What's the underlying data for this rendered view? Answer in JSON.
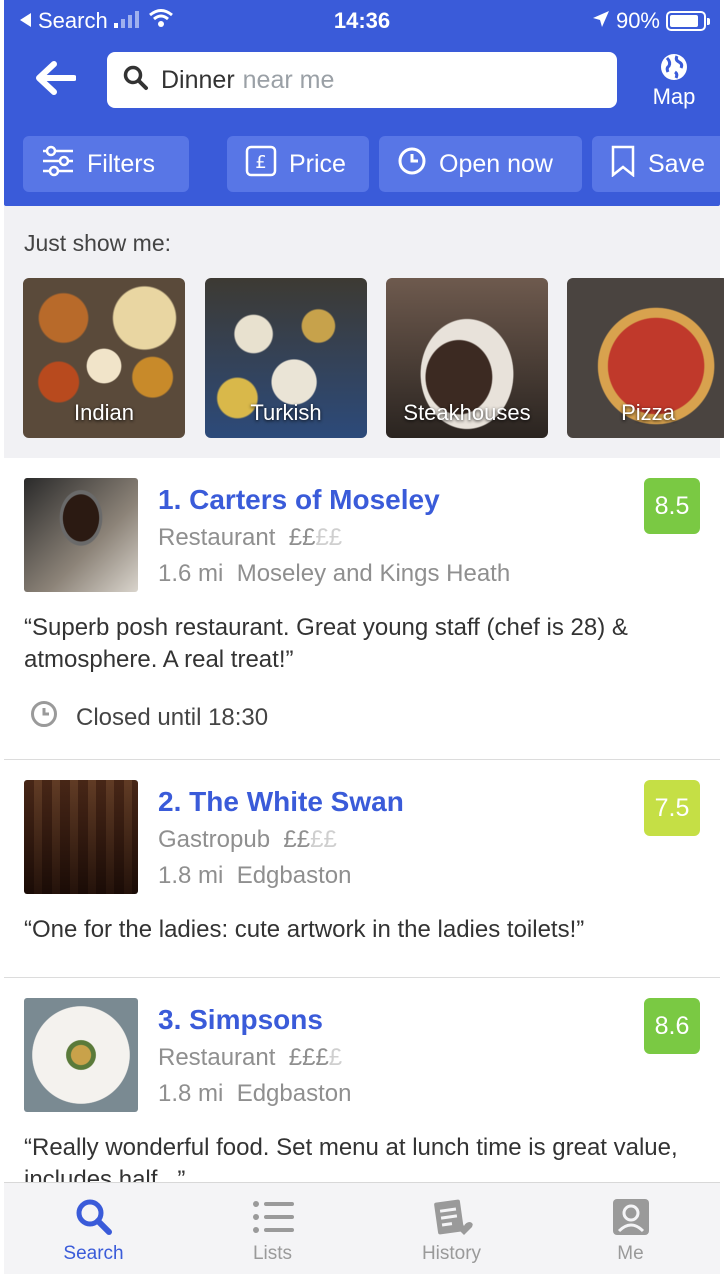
{
  "status_bar": {
    "back_app": "Search",
    "time": "14:36",
    "battery": "90%"
  },
  "search": {
    "query": "Dinner",
    "query_suffix": "near me"
  },
  "map_label": "Map",
  "chips": [
    {
      "label": "Filters",
      "icon": "sliders-icon"
    },
    {
      "label": "Price",
      "icon": "pound-icon"
    },
    {
      "label": "Open now",
      "icon": "clock-icon"
    },
    {
      "label": "Save",
      "icon": "bookmark-icon"
    }
  ],
  "categories": {
    "title": "Just show me:",
    "items": [
      {
        "label": "Indian"
      },
      {
        "label": "Turkish"
      },
      {
        "label": "Steakhouses"
      },
      {
        "label": "Pizza"
      }
    ]
  },
  "results": [
    {
      "rank_title": "1. Carters of Moseley",
      "type": "Restaurant",
      "price_active": "££",
      "price_muted": "££",
      "distance": "1.6 mi",
      "area": "Moseley and Kings Heath",
      "score": "8.5",
      "score_color": "#7ac943",
      "quote": "“Superb posh restaurant. Great young staff (chef is 28) & atmosphere. A real treat!”",
      "status": "Closed until 18:30"
    },
    {
      "rank_title": "2. The White Swan",
      "type": "Gastropub",
      "price_active": "££",
      "price_muted": "££",
      "distance": "1.8 mi",
      "area": "Edgbaston",
      "score": "7.5",
      "score_color": "#c5df45",
      "quote": "“One for the ladies: cute artwork in the ladies toilets!”"
    },
    {
      "rank_title": "3. Simpsons",
      "type": "Restaurant",
      "price_active": "£££",
      "price_muted": "£",
      "distance": "1.8 mi",
      "area": "Edgbaston",
      "score": "8.6",
      "score_color": "#7ac943",
      "quote": "“Really wonderful food. Set menu at lunch time is great value, includes half...”"
    }
  ],
  "tabs": [
    {
      "label": "Search",
      "icon": "search-icon",
      "active": true
    },
    {
      "label": "Lists",
      "icon": "list-icon"
    },
    {
      "label": "History",
      "icon": "history-icon"
    },
    {
      "label": "Me",
      "icon": "profile-icon"
    }
  ],
  "colors": {
    "brand": "#3a5bd9",
    "chip": "#5876e6"
  }
}
